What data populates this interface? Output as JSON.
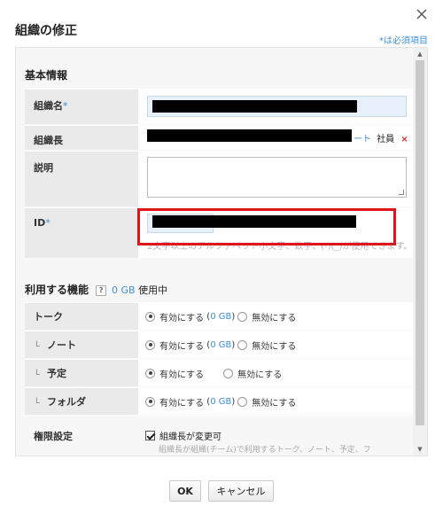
{
  "dialog": {
    "title": "組織の修正",
    "required_note": "*は必須項目",
    "close_icon": "close-icon"
  },
  "basic": {
    "section_title": "基本情報",
    "name_label": "組織名",
    "required_mark": "*",
    "leader_label": "組織長",
    "leader_link_tail": "ート",
    "leader_role": "社員",
    "remove_mark": "×",
    "description_label": "説明",
    "id_label": "ID",
    "id_hint": "2文字以上のアルファベット小文字、数字、(-)(_)が使用できます。"
  },
  "features": {
    "section_title": "利用する機能",
    "help_mark": "?",
    "usage_value": "0 GB",
    "usage_suffix": "使用中",
    "rows": [
      {
        "label": "トーク",
        "prefix": "",
        "enable": "有効にする",
        "gb": "0 GB",
        "disable": "無効にする",
        "show_gb": true
      },
      {
        "label": "ノート",
        "prefix": "L",
        "enable": "有効にする",
        "gb": "0 GB",
        "disable": "無効にする",
        "show_gb": true
      },
      {
        "label": "予定",
        "prefix": "L",
        "enable": "有効にする",
        "gb": "",
        "disable": "無効にする",
        "show_gb": false
      },
      {
        "label": "フォルダ",
        "prefix": "L",
        "enable": "有効にする",
        "gb": "0 GB",
        "disable": "無効にする",
        "show_gb": true
      }
    ],
    "permission_label": "権限設定",
    "permission_checkbox": "組織長が変更可",
    "permission_desc": "組織長が組織(チーム)で利用するトーク、ノート、予定、フ"
  },
  "footer": {
    "ok_label": "OK",
    "cancel_label": "キャンセル"
  },
  "colors": {
    "accent": "#3c8fd6",
    "highlight_frame": "#e0141a"
  }
}
